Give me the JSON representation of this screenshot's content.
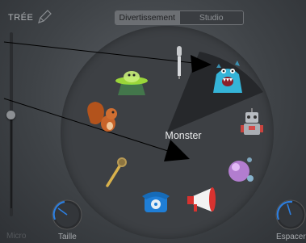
{
  "header": {
    "input_label": "TRÉE",
    "segments": [
      {
        "label": "Divertissement",
        "active": true
      },
      {
        "label": "Studio",
        "active": false
      }
    ]
  },
  "wheel": {
    "center_label": "Monster",
    "selected_item": "monster",
    "items": [
      "alien-ufo",
      "microphone-slim",
      "monster",
      "robot",
      "bubble-planet",
      "megaphone",
      "telephone",
      "golden-microphone",
      "squirrel"
    ]
  },
  "knobs": {
    "left_label": "Taille",
    "right_label": "Espacer",
    "left_value": 0.42,
    "right_value": 0.6
  },
  "footer": {
    "left_faded_text": "Micro"
  },
  "colors": {
    "background": "#45494d",
    "wheel": "#3d4044",
    "selected_wedge": "#26282b",
    "knob_accent": "#2d7fe0",
    "arrow": "#000000"
  }
}
